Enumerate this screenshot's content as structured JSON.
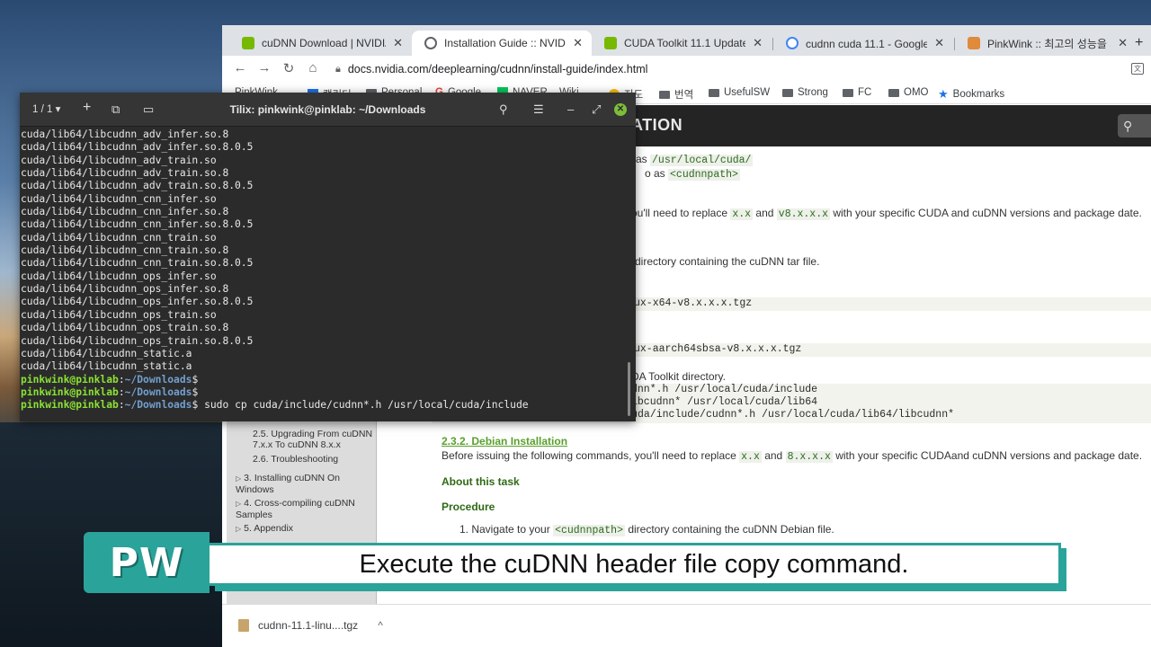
{
  "browser": {
    "tabs": [
      {
        "label": "cuDNN Download | NVIDIA D",
        "close": "✕",
        "active": false,
        "favicon_color": "#76b900"
      },
      {
        "label": "Installation Guide :: NVIDIA D",
        "close": "✕",
        "active": true,
        "favicon_color": "#5f6368"
      },
      {
        "label": "CUDA Toolkit 11.1 Update 1 D",
        "close": "✕",
        "active": false,
        "favicon_color": "#76b900"
      },
      {
        "label": "cudnn cuda 11.1 - Google 검색",
        "close": "✕",
        "active": false,
        "favicon_color": "#4285f4"
      },
      {
        "label": "PinkWink :: 최고의 성능을 자랑하",
        "close": "✕",
        "active": false,
        "favicon_color": "#e08a3c"
      }
    ],
    "new_tab": "+",
    "url": "docs.nvidia.com/deeplearning/cudnn/install-guide/index.html",
    "bookmarks": [
      "PinkWink",
      "캘린더",
      "Personal",
      "Google",
      "NAVER",
      "Wiki",
      "지도",
      "번역",
      "UsefulSW",
      "Strong",
      "FC",
      "OMO",
      "Bookmarks"
    ]
  },
  "doc": {
    "header_title": "ATION",
    "sidebar": [
      {
        "label": "2.5. Upgrading From cuDNN 7.x.x To cuDNN 8.x.x",
        "arrow": ""
      },
      {
        "label": "2.6. Troubleshooting",
        "arrow": ""
      },
      {
        "label": "3. Installing cuDNN On Windows",
        "arrow": "▷"
      },
      {
        "label": "4. Cross-compiling cuDNN Samples",
        "arrow": "▷"
      },
      {
        "label": "5. Appendix",
        "arrow": "▷"
      }
    ],
    "line1": {
      "pre": "as ",
      "code": "/usr/local/cuda/"
    },
    "line2": {
      "pre": "o as ",
      "code": "<cudnnpath>"
    },
    "line3": {
      "pre": "ou'll need to replace ",
      "code1": "x.x",
      "mid": " and ",
      "code2": "v8.x.x.x",
      "post": " with your specific CUDA and cuDNN versions and package date."
    },
    "line4": "directory containing the cuDNN tar file.",
    "code_tar1": "ux-x64-v8.x.x.x.tgz",
    "code_tar2": "ux-aarch64sbsa-v8.x.x.x.tgz",
    "line5": "DA Toolkit directory.",
    "code_copy1": "dnn*.h /usr/local/cuda/include",
    "code_copy2": "ibcudnn* /usr/local/cuda/lib64",
    "code_chmod": "$ sudo chmod a+r /usr/local/cuda/include/cudnn*.h /usr/local/cuda/lib64/libcudnn*",
    "section": "2.3.2. Debian Installation",
    "line6": {
      "pre": "Before issuing the following commands, you'll need to replace ",
      "code1": "x.x",
      "mid": " and ",
      "code2": "8.x.x.x",
      "post": " with your specific CUDAand cuDNN versions and package date."
    },
    "about": "About this task",
    "procedure": "Procedure",
    "step1": {
      "pre": "1. Navigate to your ",
      "code": "<cudnnpath>",
      "post": " directory containing the cuDNN Debian file."
    }
  },
  "download": {
    "file": "cudnn-11.1-linu....tgz",
    "chevron": "^"
  },
  "terminal": {
    "counter": "1 / 1",
    "title": "Tilix: pinkwink@pinklab: ~/Downloads",
    "lines": [
      "cuda/lib64/libcudnn_adv_infer.so.8",
      "cuda/lib64/libcudnn_adv_infer.so.8.0.5",
      "cuda/lib64/libcudnn_adv_train.so",
      "cuda/lib64/libcudnn_adv_train.so.8",
      "cuda/lib64/libcudnn_adv_train.so.8.0.5",
      "cuda/lib64/libcudnn_cnn_infer.so",
      "cuda/lib64/libcudnn_cnn_infer.so.8",
      "cuda/lib64/libcudnn_cnn_infer.so.8.0.5",
      "cuda/lib64/libcudnn_cnn_train.so",
      "cuda/lib64/libcudnn_cnn_train.so.8",
      "cuda/lib64/libcudnn_cnn_train.so.8.0.5",
      "cuda/lib64/libcudnn_ops_infer.so",
      "cuda/lib64/libcudnn_ops_infer.so.8",
      "cuda/lib64/libcudnn_ops_infer.so.8.0.5",
      "cuda/lib64/libcudnn_ops_train.so",
      "cuda/lib64/libcudnn_ops_train.so.8",
      "cuda/lib64/libcudnn_ops_train.so.8.0.5",
      "cuda/lib64/libcudnn_static.a",
      "cuda/lib64/libcudnn_static.a"
    ],
    "prompt_user": "pinkwink@pinklab",
    "prompt_sep": ":",
    "prompt_path": "~/Downloads",
    "prompt_end": "$",
    "command": " sudo cp cuda/include/cudnn*.h /usr/local/cuda/include"
  },
  "overlay": {
    "badge": "PW",
    "subtitle": "Execute the cuDNN header file copy command.",
    "accent": "#2aa39a"
  }
}
